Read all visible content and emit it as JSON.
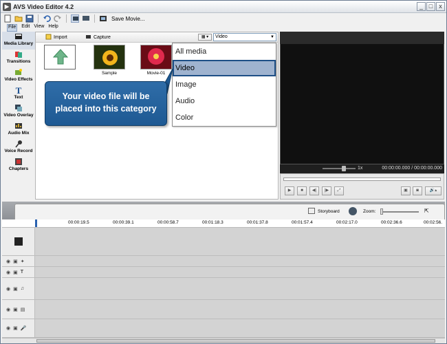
{
  "app": {
    "title": "AVS Video Editor 4.2"
  },
  "window_buttons": [
    "_",
    "□",
    "x"
  ],
  "toolbar": {
    "save_label": "Save Movie..."
  },
  "menu": [
    "File",
    "Edit",
    "View",
    "Help"
  ],
  "sidebar": {
    "items": [
      {
        "label": "Media Library",
        "icon": "media-library-icon"
      },
      {
        "label": "Transitions",
        "icon": "transitions-icon"
      },
      {
        "label": "Video Effects",
        "icon": "video-effects-icon"
      },
      {
        "label": "Text",
        "icon": "text-icon"
      },
      {
        "label": "Video Overlay",
        "icon": "video-overlay-icon"
      },
      {
        "label": "Audio Mix",
        "icon": "audio-mix-icon"
      },
      {
        "label": "Voice Record",
        "icon": "microphone-icon"
      },
      {
        "label": "Chapters",
        "icon": "chapters-icon"
      }
    ]
  },
  "media": {
    "import_label": "Import",
    "capture_label": "Capture",
    "category_selected": "Video",
    "thumbnails": [
      {
        "label": ""
      },
      {
        "label": "Sample"
      },
      {
        "label": "Movie-01"
      }
    ]
  },
  "dropdown": {
    "items": [
      "All media",
      "Video",
      "Image",
      "Audio",
      "Color"
    ],
    "selected_index": 1
  },
  "callout": {
    "text_line1": "Your video file will be",
    "text_line2": "placed into this category"
  },
  "preview": {
    "speed": "1x",
    "time": "00:00:00.000 / 00:00:00.000"
  },
  "timeline": {
    "storyboard_label": "Storyboard",
    "zoom_label": "Zoom:",
    "ruler": [
      "00:00:19.5",
      "00:00:39.1",
      "00:00:58.7",
      "00:01:18.3",
      "00:01:37.8",
      "00:01:57.4",
      "00:02:17.0",
      "00:02:36.6",
      "00:02:56."
    ]
  },
  "colors": {
    "accent": "#1e5993",
    "selection": "#9fb3cf",
    "preview_bg": "#101010"
  }
}
